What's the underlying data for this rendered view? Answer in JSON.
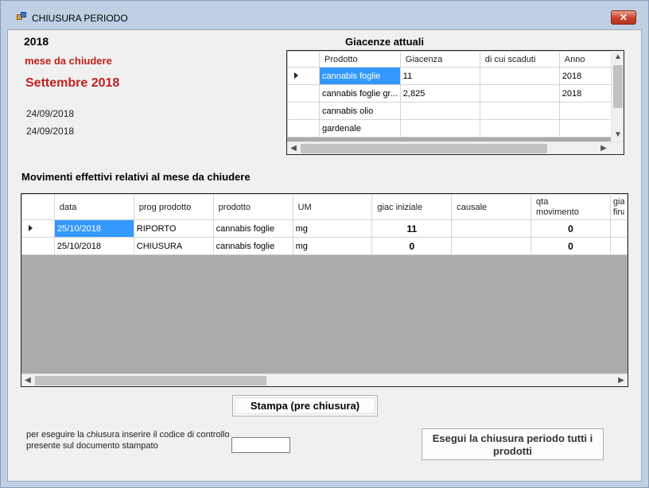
{
  "window": {
    "title": "CHIUSURA PERIODO",
    "close_glyph": "✕"
  },
  "info": {
    "year": "2018",
    "mese_label": "mese da chiudere",
    "month": "Settembre 2018",
    "date1": "24/09/2018",
    "date2": "24/09/2018"
  },
  "giacenze": {
    "title": "Giacenze attuali",
    "columns": [
      "Prodotto",
      "Giacenza",
      "di cui scaduti",
      "Anno"
    ],
    "rows": [
      [
        "cannabis foglie",
        "11",
        "",
        "2018"
      ],
      [
        "cannabis foglie gr...",
        "2,825",
        "",
        "2018"
      ],
      [
        "cannabis olio",
        "",
        "",
        ""
      ],
      [
        "gardenale",
        "",
        "",
        ""
      ]
    ]
  },
  "movimenti": {
    "title": "Movimenti effettivi relativi al mese da chiudere",
    "columns": [
      "data",
      "prog prodotto",
      "prodotto",
      "UM",
      "giac iniziale",
      "causale",
      "qta movimento",
      "gia fina"
    ],
    "rows": [
      [
        "25/10/2018",
        "RIPORTO",
        "cannabis foglie",
        "mg",
        "11",
        "",
        "0",
        ""
      ],
      [
        "25/10/2018",
        "CHIUSURA",
        "cannabis foglie",
        "mg",
        "0",
        "",
        "0",
        ""
      ]
    ]
  },
  "actions": {
    "stampa_label": "Stampa (pre chiusura)",
    "hint_line1": "per eseguire la chiusura inserire il codice di controllo",
    "hint_line2": "presente sul documento stampato",
    "code_value": "",
    "esegui_line1": "Esegui la chiusura periodo tutti i",
    "esegui_line2": "prodotti"
  },
  "colors": {
    "accent_red": "#c0201e",
    "selection": "#3399ff",
    "grid_background": "#ababab"
  },
  "icons": {
    "app": "app-window-icon",
    "row_pointer": "row-pointer-icon"
  }
}
